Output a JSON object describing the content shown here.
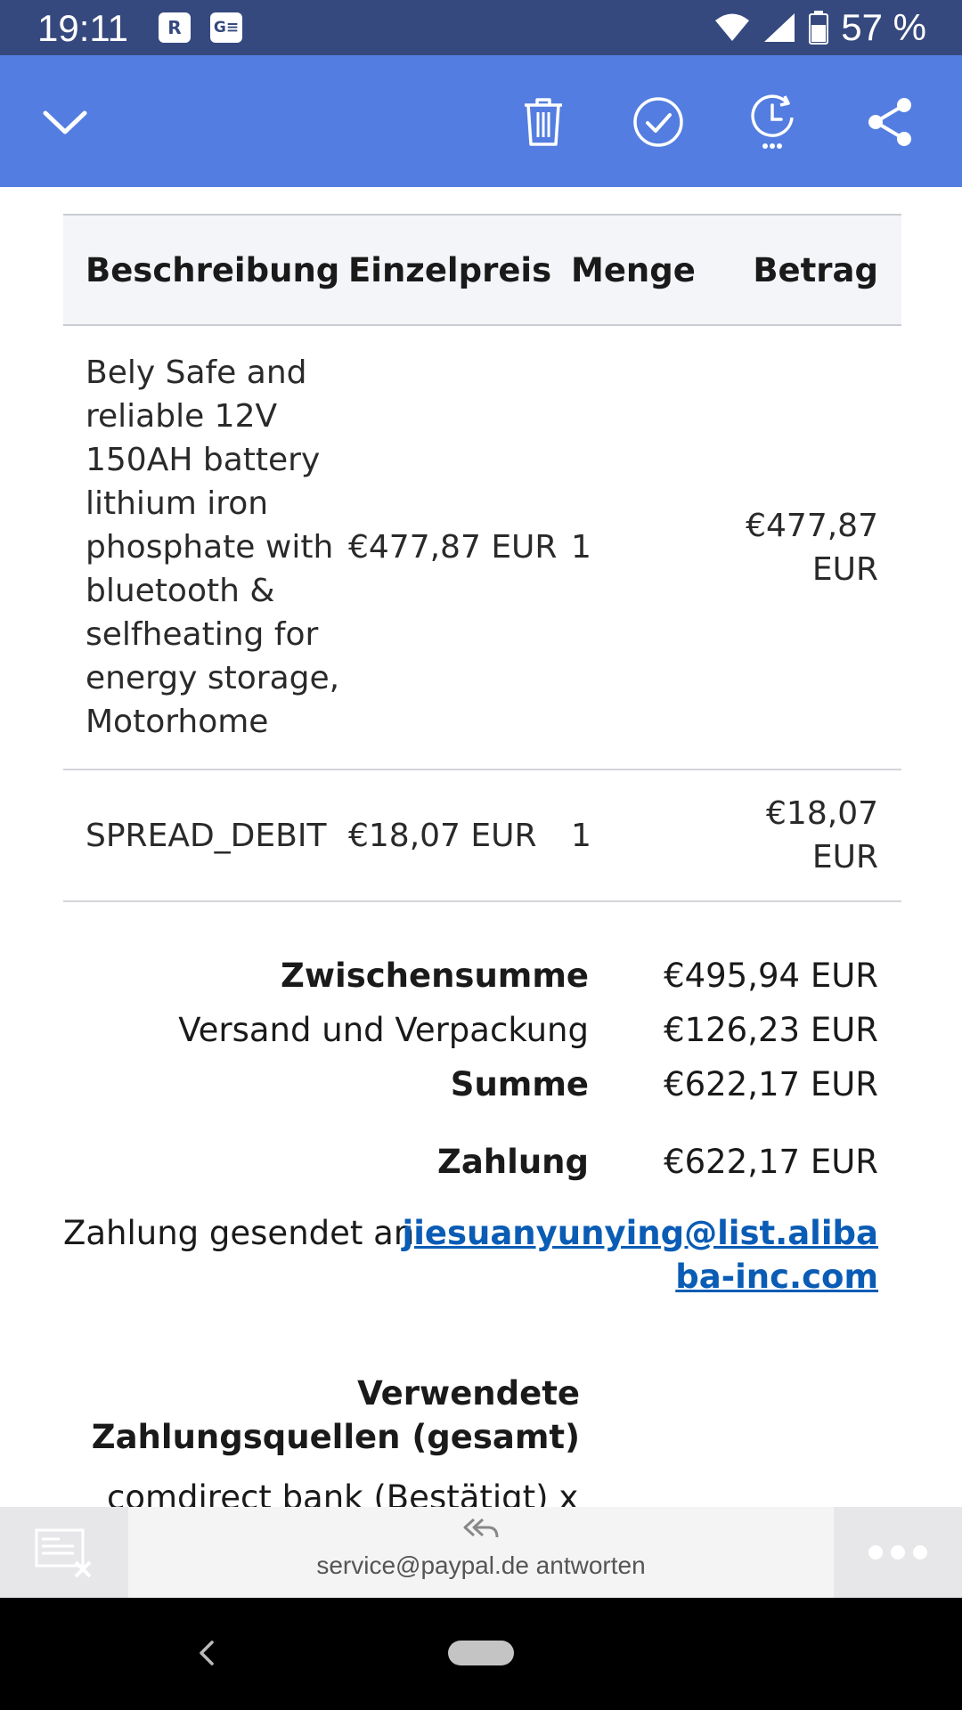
{
  "status_bar": {
    "time": "19:11",
    "battery_percent": "57 %"
  },
  "toolbar": {
    "icons": [
      "chevron-down-icon",
      "trash-icon",
      "check-circle-icon",
      "snooze-icon",
      "share-icon"
    ]
  },
  "invoice_table": {
    "headers": [
      "Beschreibung",
      "Einzelpreis",
      "Menge",
      "Betrag"
    ],
    "rows": [
      {
        "description": "Bely Safe and reliable 12V 150AH battery lithium iron phosphate with bluetooth & selfheating for energy storage, Motorhome",
        "unit_price": "€477,87 EUR",
        "quantity": "1",
        "amount": "€477,87 EUR"
      },
      {
        "description": "SPREAD_DEBIT",
        "unit_price": "€18,07 EUR",
        "quantity": "1",
        "amount": "€18,07 EUR"
      }
    ]
  },
  "summary": {
    "subtotal_label": "Zwischensumme",
    "subtotal_value": "€495,94 EUR",
    "shipping_label": "Versand und Verpackung",
    "shipping_value": "€126,23 EUR",
    "total_label": "Summe",
    "total_value": "€622,17 EUR",
    "payment_label": "Zahlung",
    "payment_value": "€622,17 EUR"
  },
  "payment_sent": {
    "prefix": "Zahlung gesendet an",
    "email": "jiesuanyunying@list.alibaba-inc.com"
  },
  "sources": {
    "title": "Verwendete Zahlungsquellen (gesamt)",
    "first_line_partial": "comdirect bank (Bestätigt) x-"
  },
  "reply_bar": {
    "label": "service@paypal.de antworten"
  },
  "colors": {
    "status_bar": "#36497e",
    "toolbar": "#537de0",
    "link": "#0a5cb5"
  }
}
